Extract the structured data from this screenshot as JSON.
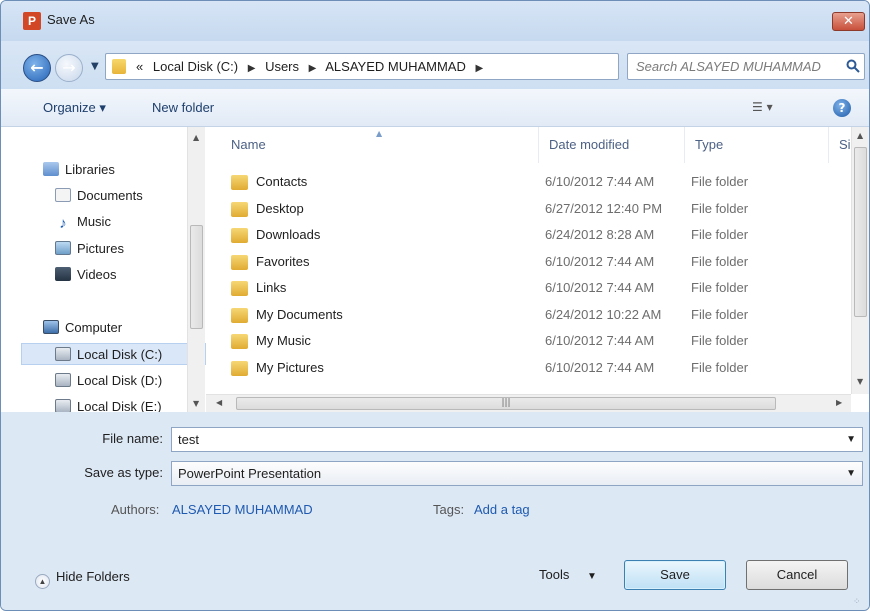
{
  "window": {
    "title": "Save As",
    "app_icon_letter": "P",
    "close_glyph": "✕"
  },
  "nav": {
    "breadcrumb": [
      "«",
      "Local Disk (C:)",
      "Users",
      "ALSAYED MUHAMMAD"
    ],
    "search_placeholder": "Search ALSAYED MUHAMMAD"
  },
  "toolbar": {
    "organize": "Organize ▾",
    "new_folder": "New folder"
  },
  "sidebar": {
    "items": [
      {
        "label": "Libraries",
        "icon": "libraries-icon",
        "level": 0
      },
      {
        "label": "Documents",
        "icon": "documents-icon",
        "level": 1
      },
      {
        "label": "Music",
        "icon": "music-icon",
        "level": 1
      },
      {
        "label": "Pictures",
        "icon": "pictures-icon",
        "level": 1
      },
      {
        "label": "Videos",
        "icon": "videos-icon",
        "level": 1
      },
      {
        "label": "Computer",
        "icon": "computer-icon",
        "level": 0
      },
      {
        "label": "Local Disk (C:)",
        "icon": "drive-icon",
        "level": 1,
        "selected": true
      },
      {
        "label": "Local Disk (D:)",
        "icon": "drive-icon",
        "level": 1
      },
      {
        "label": "Local Disk (E:)",
        "icon": "drive-icon",
        "level": 1
      }
    ]
  },
  "file_list": {
    "columns": [
      "Name",
      "Date modified",
      "Type",
      "Si"
    ],
    "rows": [
      {
        "name": "Contacts",
        "date": "6/10/2012 7:44 AM",
        "type": "File folder"
      },
      {
        "name": "Desktop",
        "date": "6/27/2012 12:40 PM",
        "type": "File folder"
      },
      {
        "name": "Downloads",
        "date": "6/24/2012 8:28 AM",
        "type": "File folder"
      },
      {
        "name": "Favorites",
        "date": "6/10/2012 7:44 AM",
        "type": "File folder"
      },
      {
        "name": "Links",
        "date": "6/10/2012 7:44 AM",
        "type": "File folder"
      },
      {
        "name": "My Documents",
        "date": "6/24/2012 10:22 AM",
        "type": "File folder"
      },
      {
        "name": "My Music",
        "date": "6/10/2012 7:44 AM",
        "type": "File folder"
      },
      {
        "name": "My Pictures",
        "date": "6/10/2012 7:44 AM",
        "type": "File folder"
      }
    ]
  },
  "form": {
    "file_name_label": "File name:",
    "file_name_value": "test",
    "save_as_type_label": "Save as type:",
    "save_as_type_value": "PowerPoint Presentation",
    "authors_label": "Authors:",
    "authors_value": "ALSAYED MUHAMMAD",
    "tags_label": "Tags:",
    "tags_value": "Add a tag"
  },
  "footer": {
    "hide_folders": "Hide Folders",
    "tools": "Tools",
    "save": "Save",
    "cancel": "Cancel"
  }
}
